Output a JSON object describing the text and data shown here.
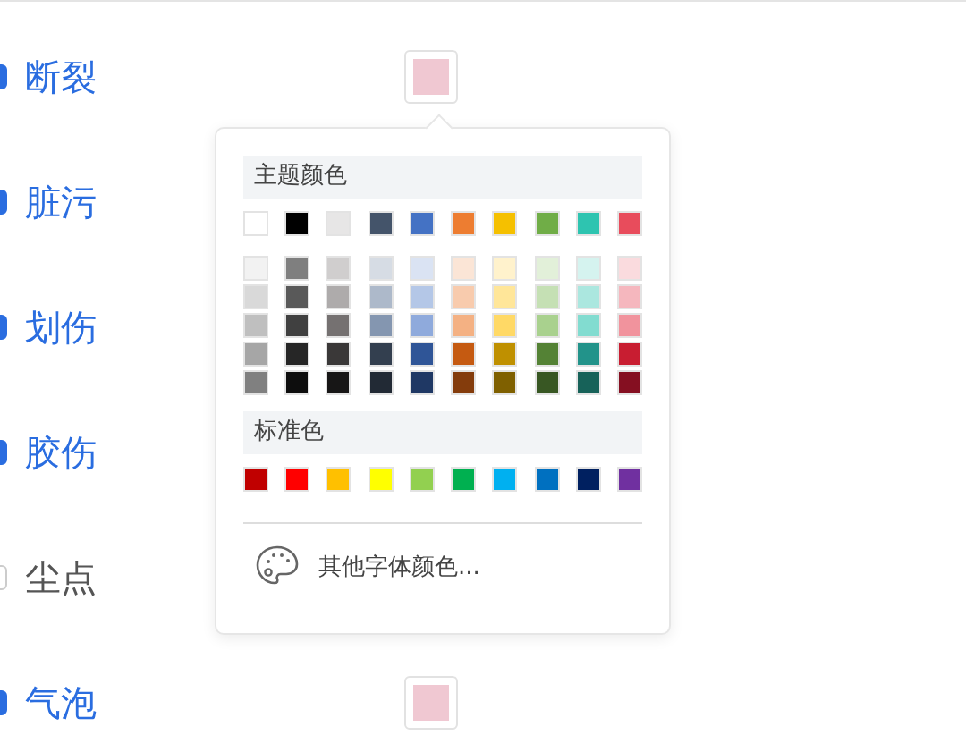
{
  "defect_items": [
    {
      "label": "断裂",
      "checked": true
    },
    {
      "label": "脏污",
      "checked": true
    },
    {
      "label": "划伤",
      "checked": true
    },
    {
      "label": "胶伤",
      "checked": true
    },
    {
      "label": "尘点",
      "checked": false
    },
    {
      "label": "气泡",
      "checked": true
    }
  ],
  "color_buttons": [
    {
      "color": "#f0c8d2"
    },
    {
      "color": "#f0c8d2"
    }
  ],
  "color_picker": {
    "theme_title": "主题颜色",
    "theme_colors": [
      {
        "color": "#ffffff"
      },
      {
        "color": "#000000"
      },
      {
        "color": "#e7e6e6"
      },
      {
        "color": "#44546a"
      },
      {
        "color": "#4472c4"
      },
      {
        "color": "#ed7d31"
      },
      {
        "color": "#f5c000"
      },
      {
        "color": "#70ad47"
      },
      {
        "color": "#2ec4b0"
      },
      {
        "color": "#e84c5c"
      }
    ],
    "shade_rows": [
      [
        {
          "color": "#f2f2f2"
        },
        {
          "color": "#7f7f7f"
        },
        {
          "color": "#d0cece"
        },
        {
          "color": "#d6dce4"
        },
        {
          "color": "#dae3f3"
        },
        {
          "color": "#fbe5d6"
        },
        {
          "color": "#fff2cc"
        },
        {
          "color": "#e2f0d9"
        },
        {
          "color": "#d5f3ef"
        },
        {
          "color": "#fadbde"
        }
      ],
      [
        {
          "color": "#d9d9d9"
        },
        {
          "color": "#595959"
        },
        {
          "color": "#aeabab"
        },
        {
          "color": "#adb9ca"
        },
        {
          "color": "#b4c7e7"
        },
        {
          "color": "#f8cbad"
        },
        {
          "color": "#ffe699"
        },
        {
          "color": "#c5e0b4"
        },
        {
          "color": "#abe7df"
        },
        {
          "color": "#f5b7be"
        }
      ],
      [
        {
          "color": "#bfbfbf"
        },
        {
          "color": "#404040"
        },
        {
          "color": "#757171"
        },
        {
          "color": "#8496b0"
        },
        {
          "color": "#8faadc"
        },
        {
          "color": "#f4b183"
        },
        {
          "color": "#ffd966"
        },
        {
          "color": "#a9d18e"
        },
        {
          "color": "#82dcd0"
        },
        {
          "color": "#f1939d"
        }
      ],
      [
        {
          "color": "#a6a6a6"
        },
        {
          "color": "#262626"
        },
        {
          "color": "#3a3838"
        },
        {
          "color": "#333f4f"
        },
        {
          "color": "#2f5597"
        },
        {
          "color": "#c55a11"
        },
        {
          "color": "#bf9000"
        },
        {
          "color": "#548235"
        },
        {
          "color": "#22938a"
        },
        {
          "color": "#c81d31"
        }
      ],
      [
        {
          "color": "#808080"
        },
        {
          "color": "#0d0d0d"
        },
        {
          "color": "#171616"
        },
        {
          "color": "#222a35"
        },
        {
          "color": "#1f3864"
        },
        {
          "color": "#843c0c"
        },
        {
          "color": "#7f6000"
        },
        {
          "color": "#385723"
        },
        {
          "color": "#176259"
        },
        {
          "color": "#850f21"
        }
      ]
    ],
    "standard_title": "标准色",
    "standard_colors": [
      {
        "color": "#c00000"
      },
      {
        "color": "#ff0000"
      },
      {
        "color": "#ffc000"
      },
      {
        "color": "#ffff00"
      },
      {
        "color": "#92d050"
      },
      {
        "color": "#00b050"
      },
      {
        "color": "#00b0f0"
      },
      {
        "color": "#0070c0"
      },
      {
        "color": "#002060"
      },
      {
        "color": "#7030a0"
      }
    ],
    "more_label": "其他字体颜色..."
  }
}
